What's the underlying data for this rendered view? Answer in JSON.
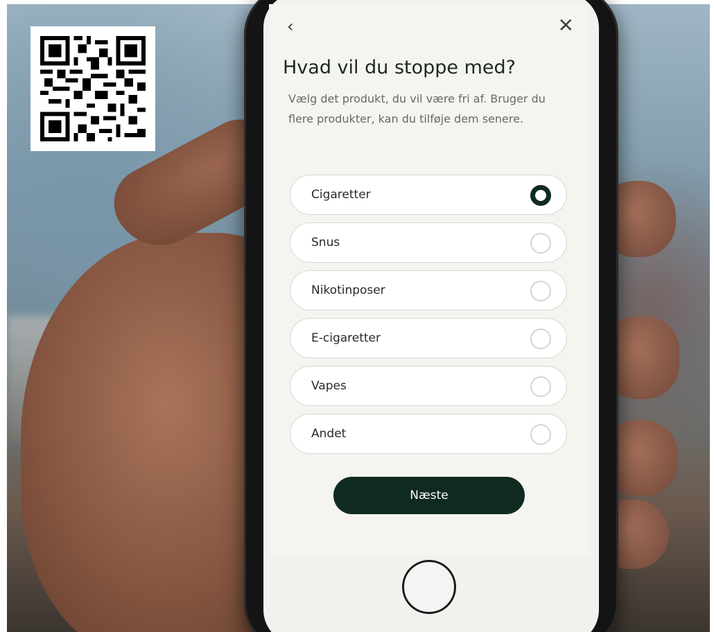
{
  "screen": {
    "back_icon": "‹",
    "close_icon": "✕",
    "title": "Hvad vil du stoppe med?",
    "subtitle": "Vælg det produkt, du vil være fri af. Bruger du flere produkter, kan du tilføje dem senere.",
    "options": [
      {
        "label": "Cigaretter",
        "selected": true
      },
      {
        "label": "Snus",
        "selected": false
      },
      {
        "label": "Nikotinposer",
        "selected": false
      },
      {
        "label": "E-cigaretter",
        "selected": false
      },
      {
        "label": "Vapes",
        "selected": false
      },
      {
        "label": "Andet",
        "selected": false
      }
    ],
    "next_label": "Næste"
  },
  "colors": {
    "accent": "#0f2a21",
    "screen_bg": "#f5f5f0",
    "option_border": "#d6d6d2"
  }
}
